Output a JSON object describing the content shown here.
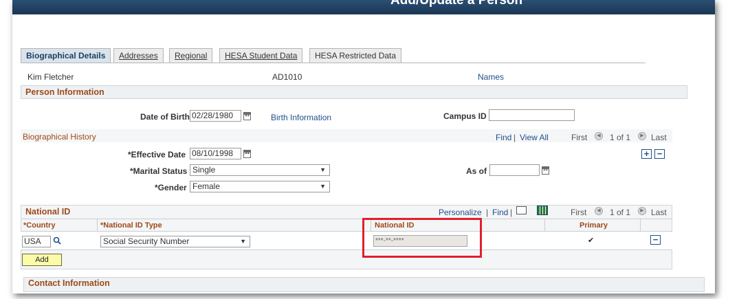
{
  "page_title": "Add/Update a Person",
  "tabs": [
    {
      "label": "Biographical Details",
      "active": true
    },
    {
      "label": "Addresses"
    },
    {
      "label": "Regional"
    },
    {
      "label": "HESA Student Data"
    },
    {
      "label": "HESA Restricted Data"
    }
  ],
  "person": {
    "name": "Kim Fletcher",
    "id": "AD1010",
    "names_link": "Names"
  },
  "person_info": {
    "title": "Person Information",
    "dob_label": "Date of Birth",
    "dob_value": "02/28/1980",
    "birth_info_link": "Birth Information",
    "campus_id_label": "Campus ID",
    "campus_id_value": ""
  },
  "bio_history": {
    "title": "Biographical History",
    "find": "Find",
    "view_all": "View All",
    "first": "First",
    "count": "1 of 1",
    "last": "Last",
    "effective_date_label": "*Effective Date",
    "effective_date_value": "08/10/1998",
    "marital_label": "*Marital Status",
    "marital_value": "Single",
    "gender_label": "*Gender",
    "gender_value": "Female",
    "as_of_label": "As of",
    "as_of_value": ""
  },
  "national_id": {
    "title": "National ID",
    "personalize": "Personalize",
    "find": "Find",
    "first": "First",
    "count": "1 of 1",
    "last": "Last",
    "columns": [
      "*Country",
      "*National ID Type",
      "National ID",
      "Primary"
    ],
    "row": {
      "country": "USA",
      "id_type": "Social Security Number",
      "national_id": "***-**-****",
      "primary": true
    },
    "add_label": "Add"
  },
  "contact": {
    "title": "Contact Information"
  },
  "colors": {
    "header": "#1f3d5e",
    "section_title": "#9c4a1a",
    "link": "#1d4f8a",
    "highlight": "#e0202a"
  }
}
